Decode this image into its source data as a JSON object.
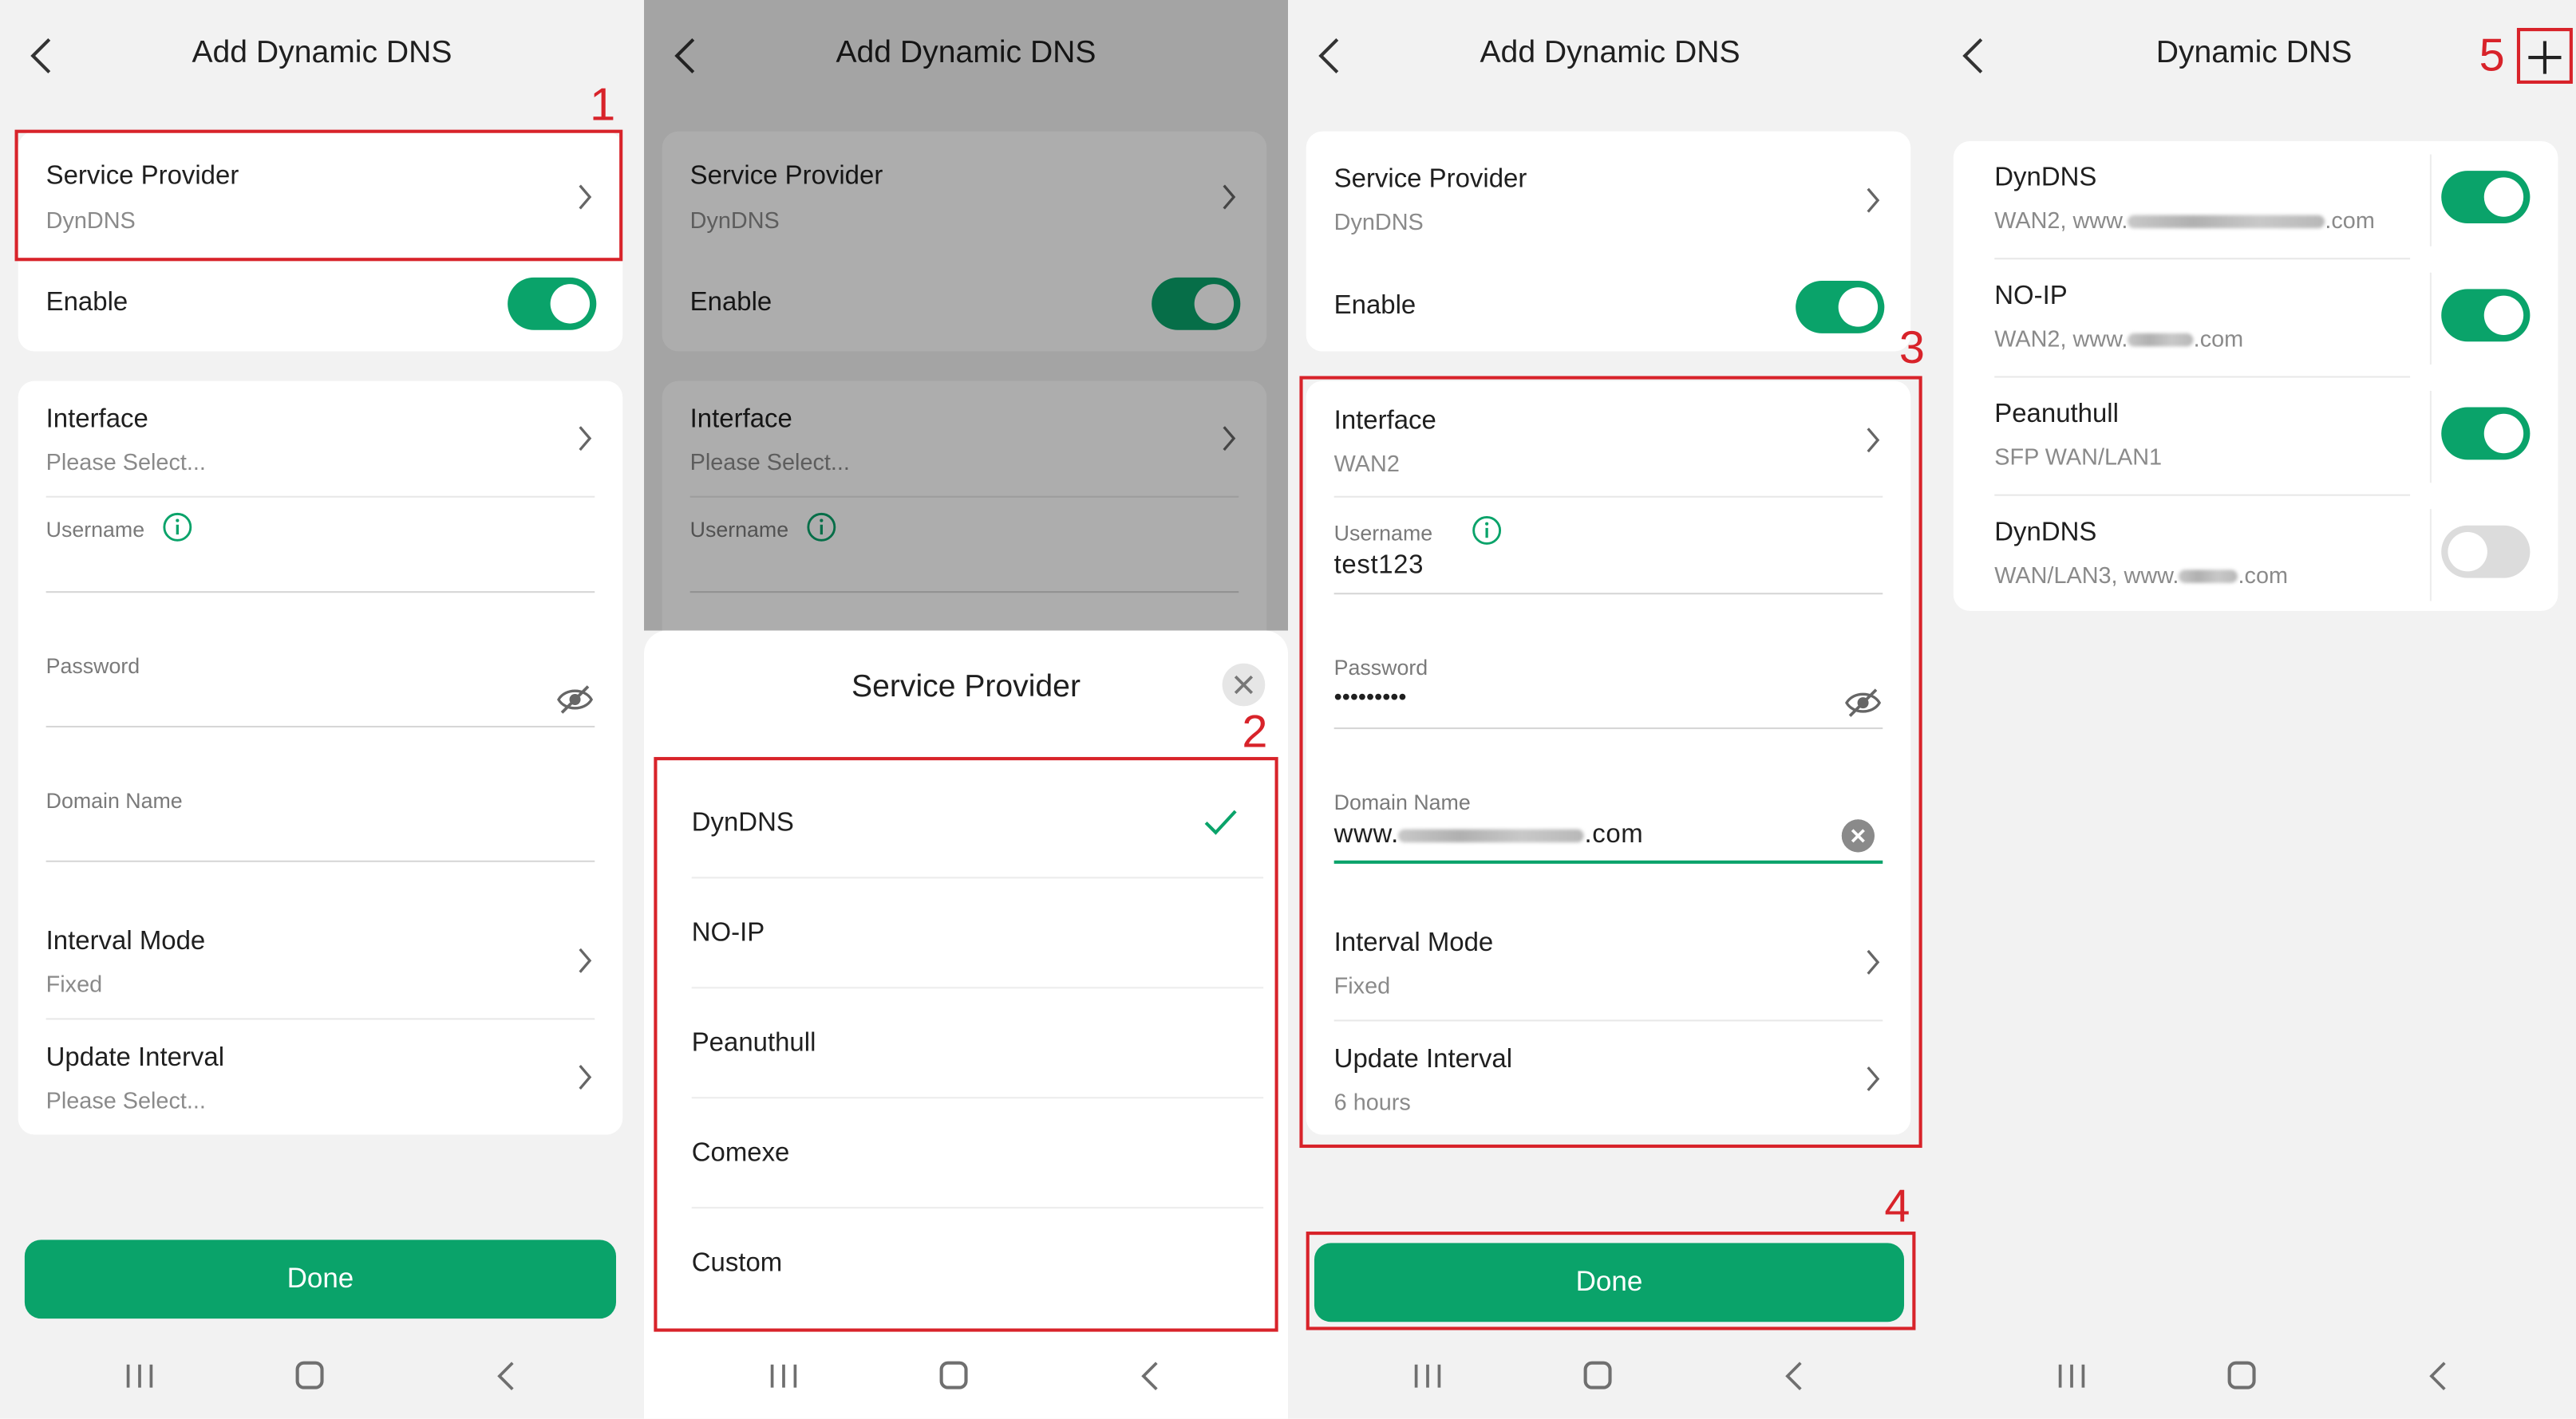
{
  "screen1": {
    "title": "Add Dynamic DNS",
    "service_provider": {
      "label": "Service Provider",
      "value": "DynDNS"
    },
    "enable": {
      "label": "Enable",
      "on": true
    },
    "interface": {
      "label": "Interface",
      "value": "Please Select..."
    },
    "username": {
      "label": "Username"
    },
    "password": {
      "label": "Password"
    },
    "domain": {
      "label": "Domain Name"
    },
    "interval_mode": {
      "label": "Interval Mode",
      "value": "Fixed"
    },
    "update_interval": {
      "label": "Update Interval",
      "value": "Please Select..."
    },
    "done": "Done",
    "step": "1"
  },
  "screen2": {
    "title": "Add Dynamic DNS",
    "service_provider": {
      "label": "Service Provider",
      "value": "DynDNS"
    },
    "enable": {
      "label": "Enable",
      "on": true
    },
    "interface": {
      "label": "Interface",
      "value": "Please Select..."
    },
    "username": {
      "label": "Username"
    },
    "sheet_title": "Service Provider",
    "options": [
      "DynDNS",
      "NO-IP",
      "Peanuthull",
      "Comexe",
      "Custom"
    ],
    "selected": "DynDNS",
    "step": "2"
  },
  "screen3": {
    "title": "Add Dynamic DNS",
    "service_provider": {
      "label": "Service Provider",
      "value": "DynDNS"
    },
    "enable": {
      "label": "Enable",
      "on": true
    },
    "interface": {
      "label": "Interface",
      "value": "WAN2"
    },
    "username": {
      "label": "Username",
      "value": "test123"
    },
    "password": {
      "label": "Password",
      "value": "•••••••••"
    },
    "domain": {
      "label": "Domain Name",
      "prefix": "www.",
      "suffix": ".com"
    },
    "interval_mode": {
      "label": "Interval Mode",
      "value": "Fixed"
    },
    "update_interval": {
      "label": "Update Interval",
      "value": "6 hours"
    },
    "done": "Done",
    "step_fields": "3",
    "step_done": "4"
  },
  "screen4": {
    "title": "Dynamic DNS",
    "step": "5",
    "entries": [
      {
        "name": "DynDNS",
        "desc_prefix": "WAN2, www.",
        "desc_suffix": ".com",
        "blurred": true,
        "on": true
      },
      {
        "name": "NO-IP",
        "desc_prefix": "WAN2, www.",
        "desc_suffix": ".com",
        "blurred": true,
        "on": true
      },
      {
        "name": "Peanuthull",
        "desc_prefix": "SFP WAN/LAN1",
        "desc_suffix": "",
        "blurred": false,
        "on": true
      },
      {
        "name": "DynDNS",
        "desc_prefix": "WAN/LAN3, www.",
        "desc_suffix": ".com",
        "blurred": true,
        "on": false
      }
    ]
  },
  "colors": {
    "accent": "#0aa36a",
    "annotation": "#d8232a"
  }
}
